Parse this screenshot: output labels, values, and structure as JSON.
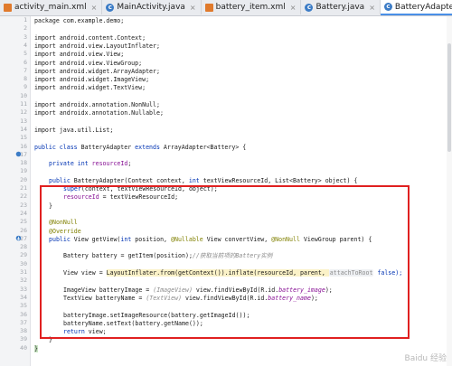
{
  "tabs": [
    {
      "label": "activity_main.xml",
      "icon": "xml-file-icon",
      "active": false
    },
    {
      "label": "MainActivity.java",
      "icon": "java-class-icon",
      "active": false
    },
    {
      "label": "battery_item.xml",
      "icon": "xml-file-icon",
      "active": false
    },
    {
      "label": "Battery.java",
      "icon": "java-class-icon",
      "active": false
    },
    {
      "label": "BatteryAdapter.java",
      "icon": "java-class-icon",
      "active": true
    }
  ],
  "line_numbers": [
    "1",
    "2",
    "3",
    "4",
    "5",
    "6",
    "7",
    "8",
    "9",
    "10",
    "11",
    "12",
    "13",
    "14",
    "15",
    "16",
    "17",
    "18",
    "19",
    "20",
    "21",
    "22",
    "23",
    "24",
    "25",
    "26",
    "27",
    "28",
    "29",
    "30",
    "31",
    "32",
    "33",
    "34",
    "35",
    "36",
    "37",
    "38",
    "39",
    "40"
  ],
  "code": {
    "l1": "package com.example.demo;",
    "l3": "import android.content.Context;",
    "l4": "import android.view.LayoutInflater;",
    "l5": "import android.view.View;",
    "l6": "import android.view.ViewGroup;",
    "l7": "import android.widget.ArrayAdapter;",
    "l8": "import android.widget.ImageView;",
    "l9": "import android.widget.TextView;",
    "l11": "import androidx.annotation.NonNull;",
    "l12": "import androidx.annotation.Nullable;",
    "l14": "import java.util.List;",
    "l16a": "public class ",
    "l16b": "BatteryAdapter ",
    "l16c": "extends ",
    "l16d": "ArrayAdapter<Battery> {",
    "l18a": "private int ",
    "l18b": "resourceId",
    "l18c": ";",
    "l20a": "public ",
    "l20b": "BatteryAdapter(Context context, ",
    "l20c": "int ",
    "l20d": "textViewResourceId, List<Battery> object) {",
    "l21a": "super",
    "l21b": "(context, textViewResourceId, object);",
    "l22a": "resourceId",
    "l22b": " = textViewResourceId;",
    "l23": "}",
    "l25": "@NonNull",
    "l26": "@Override",
    "l27a": "public ",
    "l27b": "View getView(",
    "l27c": "int ",
    "l27d": "position, ",
    "l27e": "@Nullable ",
    "l27f": "View convertView, ",
    "l27g": "@NonNull ",
    "l27h": "ViewGroup parent) {",
    "l29a": "Battery battery = getItem(position);",
    "l29b": "//获取当前项的Battery实例",
    "l31a": "View view = ",
    "l31b": "LayoutInflater.from(getContext()).inflate(resourceId, parent, ",
    "l31c": "attachToRoot",
    "l31d": " false);",
    "l33a": "ImageView batteryImage = ",
    "l33b": "(ImageView)",
    "l33c": " view.findViewById(R.id.",
    "l33d": "battery_image",
    "l33e": ");",
    "l34a": "TextView batteryName = ",
    "l34b": "(TextView)",
    "l34c": " view.findViewById(R.id.",
    "l34d": "battery_name",
    "l34e": ");",
    "l36": "batteryImage.setImageResource(battery.getImageId());",
    "l37": "batteryName.setText(battery.getName());",
    "l38a": "return ",
    "l38b": "view;",
    "l39": "}",
    "l40": "}"
  },
  "watermark": "Baidu 经验",
  "colors": {
    "highlight_box": "#e02020",
    "keyword": "#0033b3",
    "annotation": "#808000",
    "field": "#871094"
  }
}
